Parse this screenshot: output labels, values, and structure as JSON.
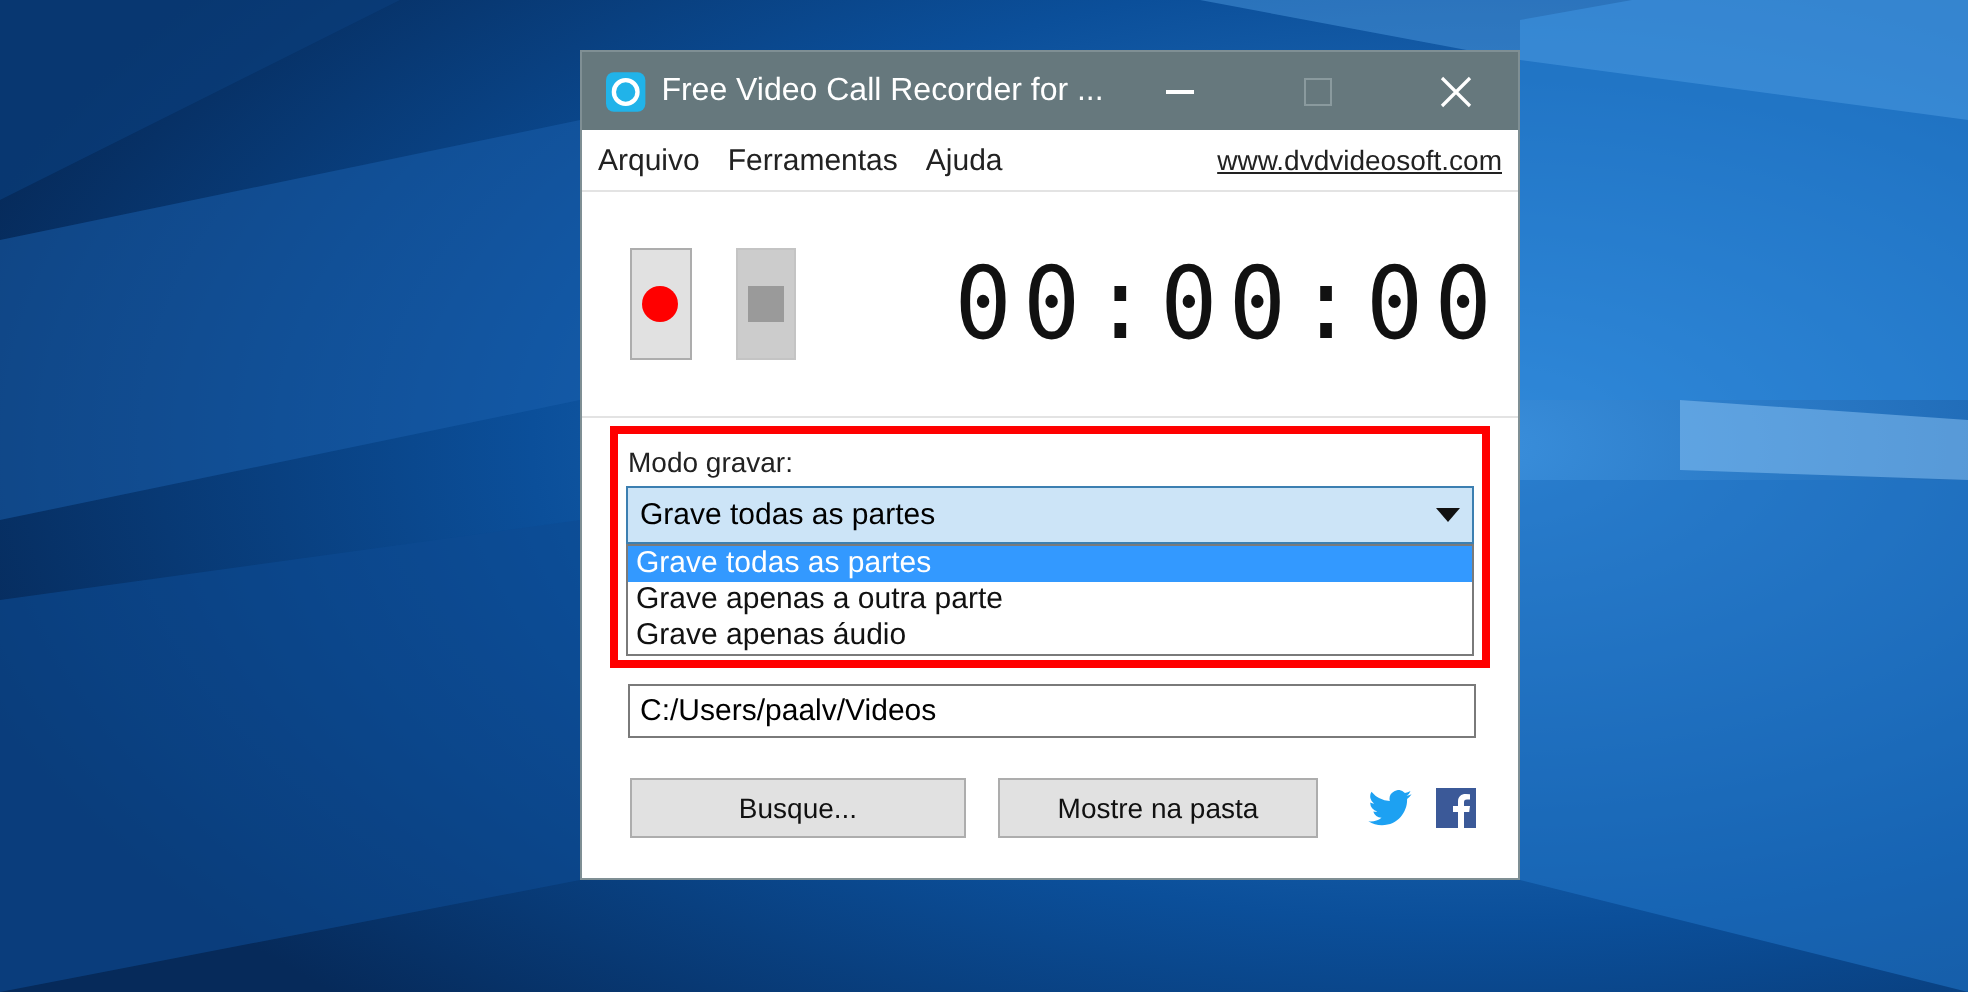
{
  "window": {
    "title": "Free Video Call Recorder for ..."
  },
  "menu": [
    {
      "label": "Arquivo"
    },
    {
      "label": "Ferramentas"
    },
    {
      "label": "Ajuda"
    }
  ],
  "website_link": "www.dvdvideosoft.com",
  "transport": [
    {
      "kind": "record",
      "disabled": false
    },
    {
      "kind": "stop",
      "disabled": true
    }
  ],
  "timer": "00:00:00",
  "record_mode": {
    "label": "Modo gravar:",
    "value": "Grave todas as partes",
    "expanded": true,
    "options": [
      {
        "label": "Grave todas as partes",
        "selected": true
      },
      {
        "label": "Grave apenas a outra parte",
        "selected": false
      },
      {
        "label": "Grave apenas áudio",
        "selected": false
      }
    ]
  },
  "output_path": {
    "value": "C:/Users/paalv/Videos"
  },
  "buttons": [
    {
      "label": "Busque..."
    },
    {
      "label": "Mostre na pasta"
    }
  ],
  "social": [
    {
      "kind": "twitter"
    },
    {
      "kind": "facebook"
    }
  ]
}
